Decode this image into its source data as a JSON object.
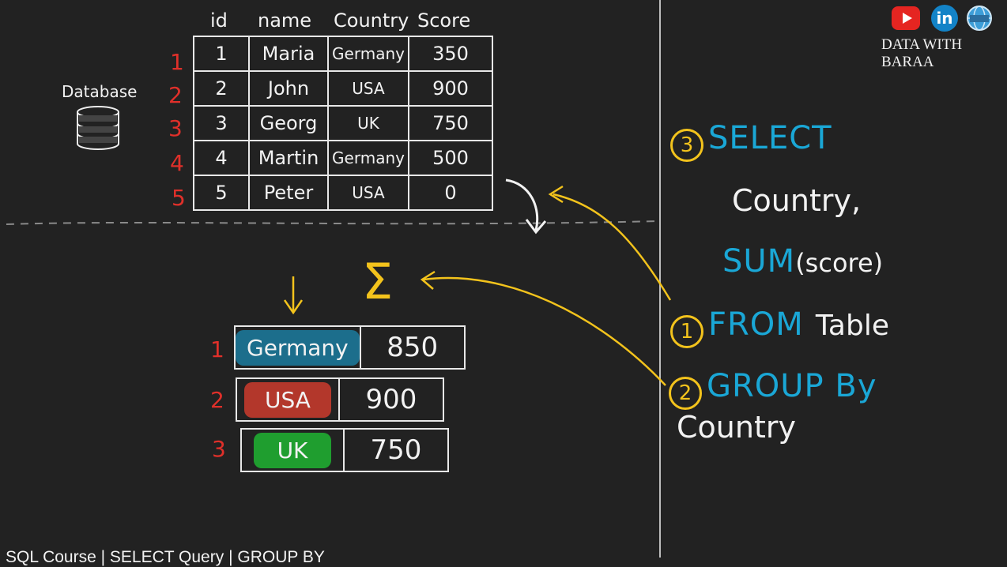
{
  "source_table": {
    "headers": [
      "id",
      "name",
      "Country",
      "Score"
    ],
    "rows": [
      [
        "1",
        "Maria",
        "Germany",
        "350"
      ],
      [
        "2",
        "John",
        "USA",
        "900"
      ],
      [
        "3",
        "Georg",
        "UK",
        "750"
      ],
      [
        "4",
        "Martin",
        "Germany",
        "500"
      ],
      [
        "5",
        "Peter",
        "USA",
        "0"
      ]
    ],
    "row_numbers": [
      "1",
      "2",
      "3",
      "4",
      "5"
    ]
  },
  "database_label": "Database",
  "sigma_symbol": "Σ",
  "result_table": {
    "rows": [
      {
        "num": "1",
        "country": "Germany",
        "score": "850",
        "color": "#1c6e8c"
      },
      {
        "num": "2",
        "country": "USA",
        "score": "900",
        "color": "#b3372b"
      },
      {
        "num": "3",
        "country": "UK",
        "score": "750",
        "color": "#1f9e2f"
      }
    ]
  },
  "query": {
    "step3": "3",
    "select_kw": "SELECT",
    "country_col": "Country,",
    "sum_kw": "SUM",
    "sum_arg": "(score)",
    "step1": "1",
    "from_kw": "FROM",
    "from_table": "Table",
    "step2": "2",
    "group_kw": "GROUP By",
    "group_col": "Country"
  },
  "brand": {
    "name": "DATA WITH BARAA",
    "icons": [
      "youtube-icon",
      "linkedin-icon",
      "website-icon"
    ]
  },
  "footer": "SQL Course | SELECT Query | GROUP BY",
  "colors": {
    "background": "#222222",
    "red": "#e0302a",
    "blue": "#1aa7d6",
    "yellow": "#f3c31c"
  }
}
